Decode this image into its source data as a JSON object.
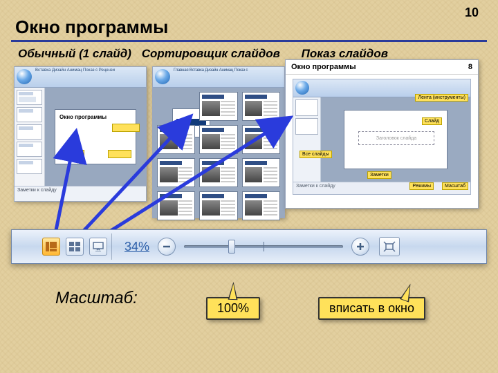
{
  "page_number": "10",
  "title": "Окно программы",
  "modes": {
    "normal": "Обычный (1 слайд)",
    "sorter": "Сортировщик слайдов",
    "show": "Показ слайдов"
  },
  "sample_slide": {
    "title": "Окно программы",
    "page_num": "8",
    "annotations": {
      "ribbon": "Лента (инструменты)",
      "all_slides": "Все слайды",
      "slide": "Слайд",
      "notes": "Заметки",
      "modes": "Режимы",
      "zoom": "Масштаб"
    },
    "placeholder": "Заголовок слайда",
    "notes_hint": "Заметки к слайду",
    "status_hint": "Заметки к слайду"
  },
  "shot1": {
    "tabs": "Вставка  Дизайн  Анимац  Показ с  Рецензи",
    "notes": "Заметки к слайду"
  },
  "shot2": {
    "tabs": "Главная  Вставка  Дизайн  Анимац  Показ с"
  },
  "statusbar": {
    "zoom_percent": "34%"
  },
  "scale_label": "Масштаб:",
  "callouts": {
    "hundred": "100%",
    "fit": "вписать в окно"
  }
}
